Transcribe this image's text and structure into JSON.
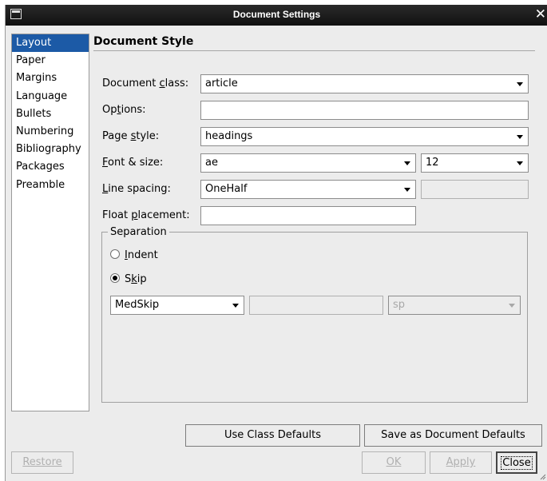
{
  "window": {
    "title": "Document Settings"
  },
  "sidebar": {
    "items": [
      "Layout",
      "Paper",
      "Margins",
      "Language",
      "Bullets",
      "Numbering",
      "Bibliography",
      "Packages",
      "Preamble"
    ],
    "selected": "Layout"
  },
  "panel": {
    "heading": "Document Style",
    "document_class": {
      "label_pre": "Document ",
      "label_key": "c",
      "label_post": "lass:",
      "value": "article"
    },
    "options": {
      "label_pre": "Op",
      "label_key": "t",
      "label_post": "ions:",
      "value": ""
    },
    "page_style": {
      "label_pre": "Page ",
      "label_key": "s",
      "label_post": "tyle:",
      "value": "headings"
    },
    "font_size": {
      "label_pre": "",
      "label_key": "F",
      "label_post": "ont & size:",
      "font": "ae",
      "size": "12"
    },
    "line_spacing": {
      "label_pre": "",
      "label_key": "L",
      "label_post": "ine spacing:",
      "value": "OneHalf",
      "custom": ""
    },
    "float_placement": {
      "label_pre": "Float ",
      "label_key": "p",
      "label_post": "lacement:",
      "value": ""
    },
    "separation": {
      "legend": "Separation",
      "indent": {
        "label_pre": "",
        "label_key": "I",
        "label_post": "ndent",
        "checked": false
      },
      "skip": {
        "label_pre": "S",
        "label_key": "k",
        "label_post": "ip",
        "checked": true
      },
      "skip_value": "MedSkip",
      "skip_length": "",
      "skip_unit": "sp"
    }
  },
  "buttons": {
    "use_class_defaults": "Use Class Defaults",
    "save_document_defaults": "Save as Document Defaults",
    "restore": "Restore",
    "ok": "OK",
    "apply": "Apply",
    "close": "Close"
  },
  "colors": {
    "selection": "#1c5aa6",
    "titlebar": "#1a1a1a",
    "dialog_bg": "#ececec"
  }
}
